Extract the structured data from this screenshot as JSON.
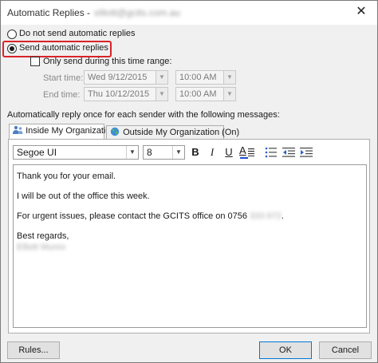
{
  "window": {
    "title": "Automatic Replies - ",
    "account": "elliott@gcits.com.au",
    "close_glyph": "✕"
  },
  "options": {
    "do_not_send_label": "Do not send automatic replies",
    "send_label": "Send automatic replies",
    "send_selected": true,
    "time_range_label": "Only send during this time range:",
    "time_range_checked": false
  },
  "time_range": {
    "start_label": "Start time:",
    "start_date": "Wed 9/12/2015",
    "start_time": "10:00 AM",
    "end_label": "End time:",
    "end_date": "Thu 10/12/2015",
    "end_time": "10:00 AM"
  },
  "instructions": "Automatically reply once for each sender with the following messages:",
  "tabs": [
    {
      "label": "Inside My Organization",
      "icon": "people-icon",
      "active": true
    },
    {
      "label": "Outside My Organization (On)",
      "icon": "globe-icon",
      "active": false
    }
  ],
  "format": {
    "font_family": "Segoe UI",
    "font_size": "8",
    "bold": "B",
    "italic": "I",
    "underline": "U",
    "font_color": "A"
  },
  "message": {
    "line1": "Thank you for your email.",
    "line2": "I will be out of the office this week.",
    "line3": "For urgent issues, please contact the GCITS office on 0756 ",
    "line3_phone": "333 672",
    "line3_end": ".",
    "line4": "Best regards,",
    "line5": "Elliott Munro"
  },
  "buttons": {
    "rules": "Rules...",
    "ok": "OK",
    "cancel": "Cancel"
  },
  "colors": {
    "highlight": "#d9232a",
    "accent": "#0078d7"
  }
}
